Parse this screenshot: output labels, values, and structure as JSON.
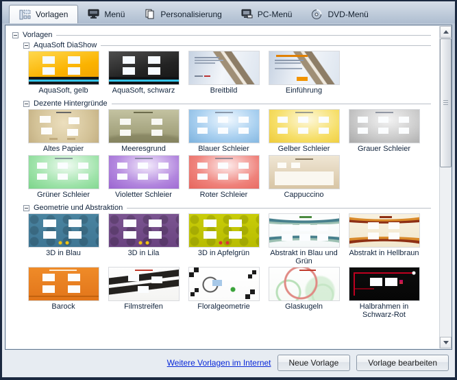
{
  "tabs": [
    {
      "label": "Vorlagen",
      "active": true
    },
    {
      "label": "Menü",
      "active": false
    },
    {
      "label": "Personalisierung",
      "active": false
    },
    {
      "label": "PC-Menü",
      "active": false
    },
    {
      "label": "DVD-Menü",
      "active": false
    }
  ],
  "tree": {
    "root_label": "Vorlagen",
    "groups": [
      {
        "label": "AquaSoft DiaShow",
        "items": [
          {
            "label": "AquaSoft, gelb",
            "thumb": "aqua-gelb"
          },
          {
            "label": "AquaSoft, schwarz",
            "thumb": "aqua-schwarz"
          },
          {
            "label": "Breitbild",
            "thumb": "breitbild"
          },
          {
            "label": "Einführung",
            "thumb": "einfuehrung"
          }
        ]
      },
      {
        "label": "Dezente Hintergründe",
        "items": [
          {
            "label": "Altes Papier",
            "thumb": "altes-papier"
          },
          {
            "label": "Meeresgrund",
            "thumb": "meeresgrund"
          },
          {
            "label": "Blauer Schleier",
            "thumb": "blauer-schleier"
          },
          {
            "label": "Gelber Schleier",
            "thumb": "gelber-schleier"
          },
          {
            "label": "Grauer Schleier",
            "thumb": "grauer-schleier"
          },
          {
            "label": "Grüner Schleier",
            "thumb": "gruener-schleier"
          },
          {
            "label": "Violetter Schleier",
            "thumb": "violetter-schleier"
          },
          {
            "label": "Roter Schleier",
            "thumb": "roter-schleier"
          },
          {
            "label": "Cappuccino",
            "thumb": "cappuccino"
          }
        ]
      },
      {
        "label": "Geometrie und Abstraktion",
        "items": [
          {
            "label": "3D in Blau",
            "thumb": "3d-blau"
          },
          {
            "label": "3D in Lila",
            "thumb": "3d-lila"
          },
          {
            "label": "3D in Apfelgrün",
            "thumb": "3d-apfelgruen"
          },
          {
            "label": "Abstrakt in Blau und Grün",
            "thumb": "abstrakt-blau-gruen"
          },
          {
            "label": "Abstrakt in Hellbraun",
            "thumb": "abstrakt-hellbraun"
          },
          {
            "label": "Barock",
            "thumb": "barock"
          },
          {
            "label": "Filmstreifen",
            "thumb": "filmstreifen"
          },
          {
            "label": "Floralgeometrie",
            "thumb": "floralgeometrie"
          },
          {
            "label": "Glaskugeln",
            "thumb": "glaskugeln"
          },
          {
            "label": "Halbrahmen in Schwarz-Rot",
            "thumb": "halbrahmen-schwarz-rot"
          }
        ]
      }
    ]
  },
  "footer": {
    "link": "Weitere Vorlagen im Internet",
    "new_button": "Neue Vorlage",
    "edit_button": "Vorlage bearbeiten"
  },
  "colors": {
    "window_border": "#1b2940",
    "link": "#0626d8",
    "panel_border": "#64788f"
  }
}
